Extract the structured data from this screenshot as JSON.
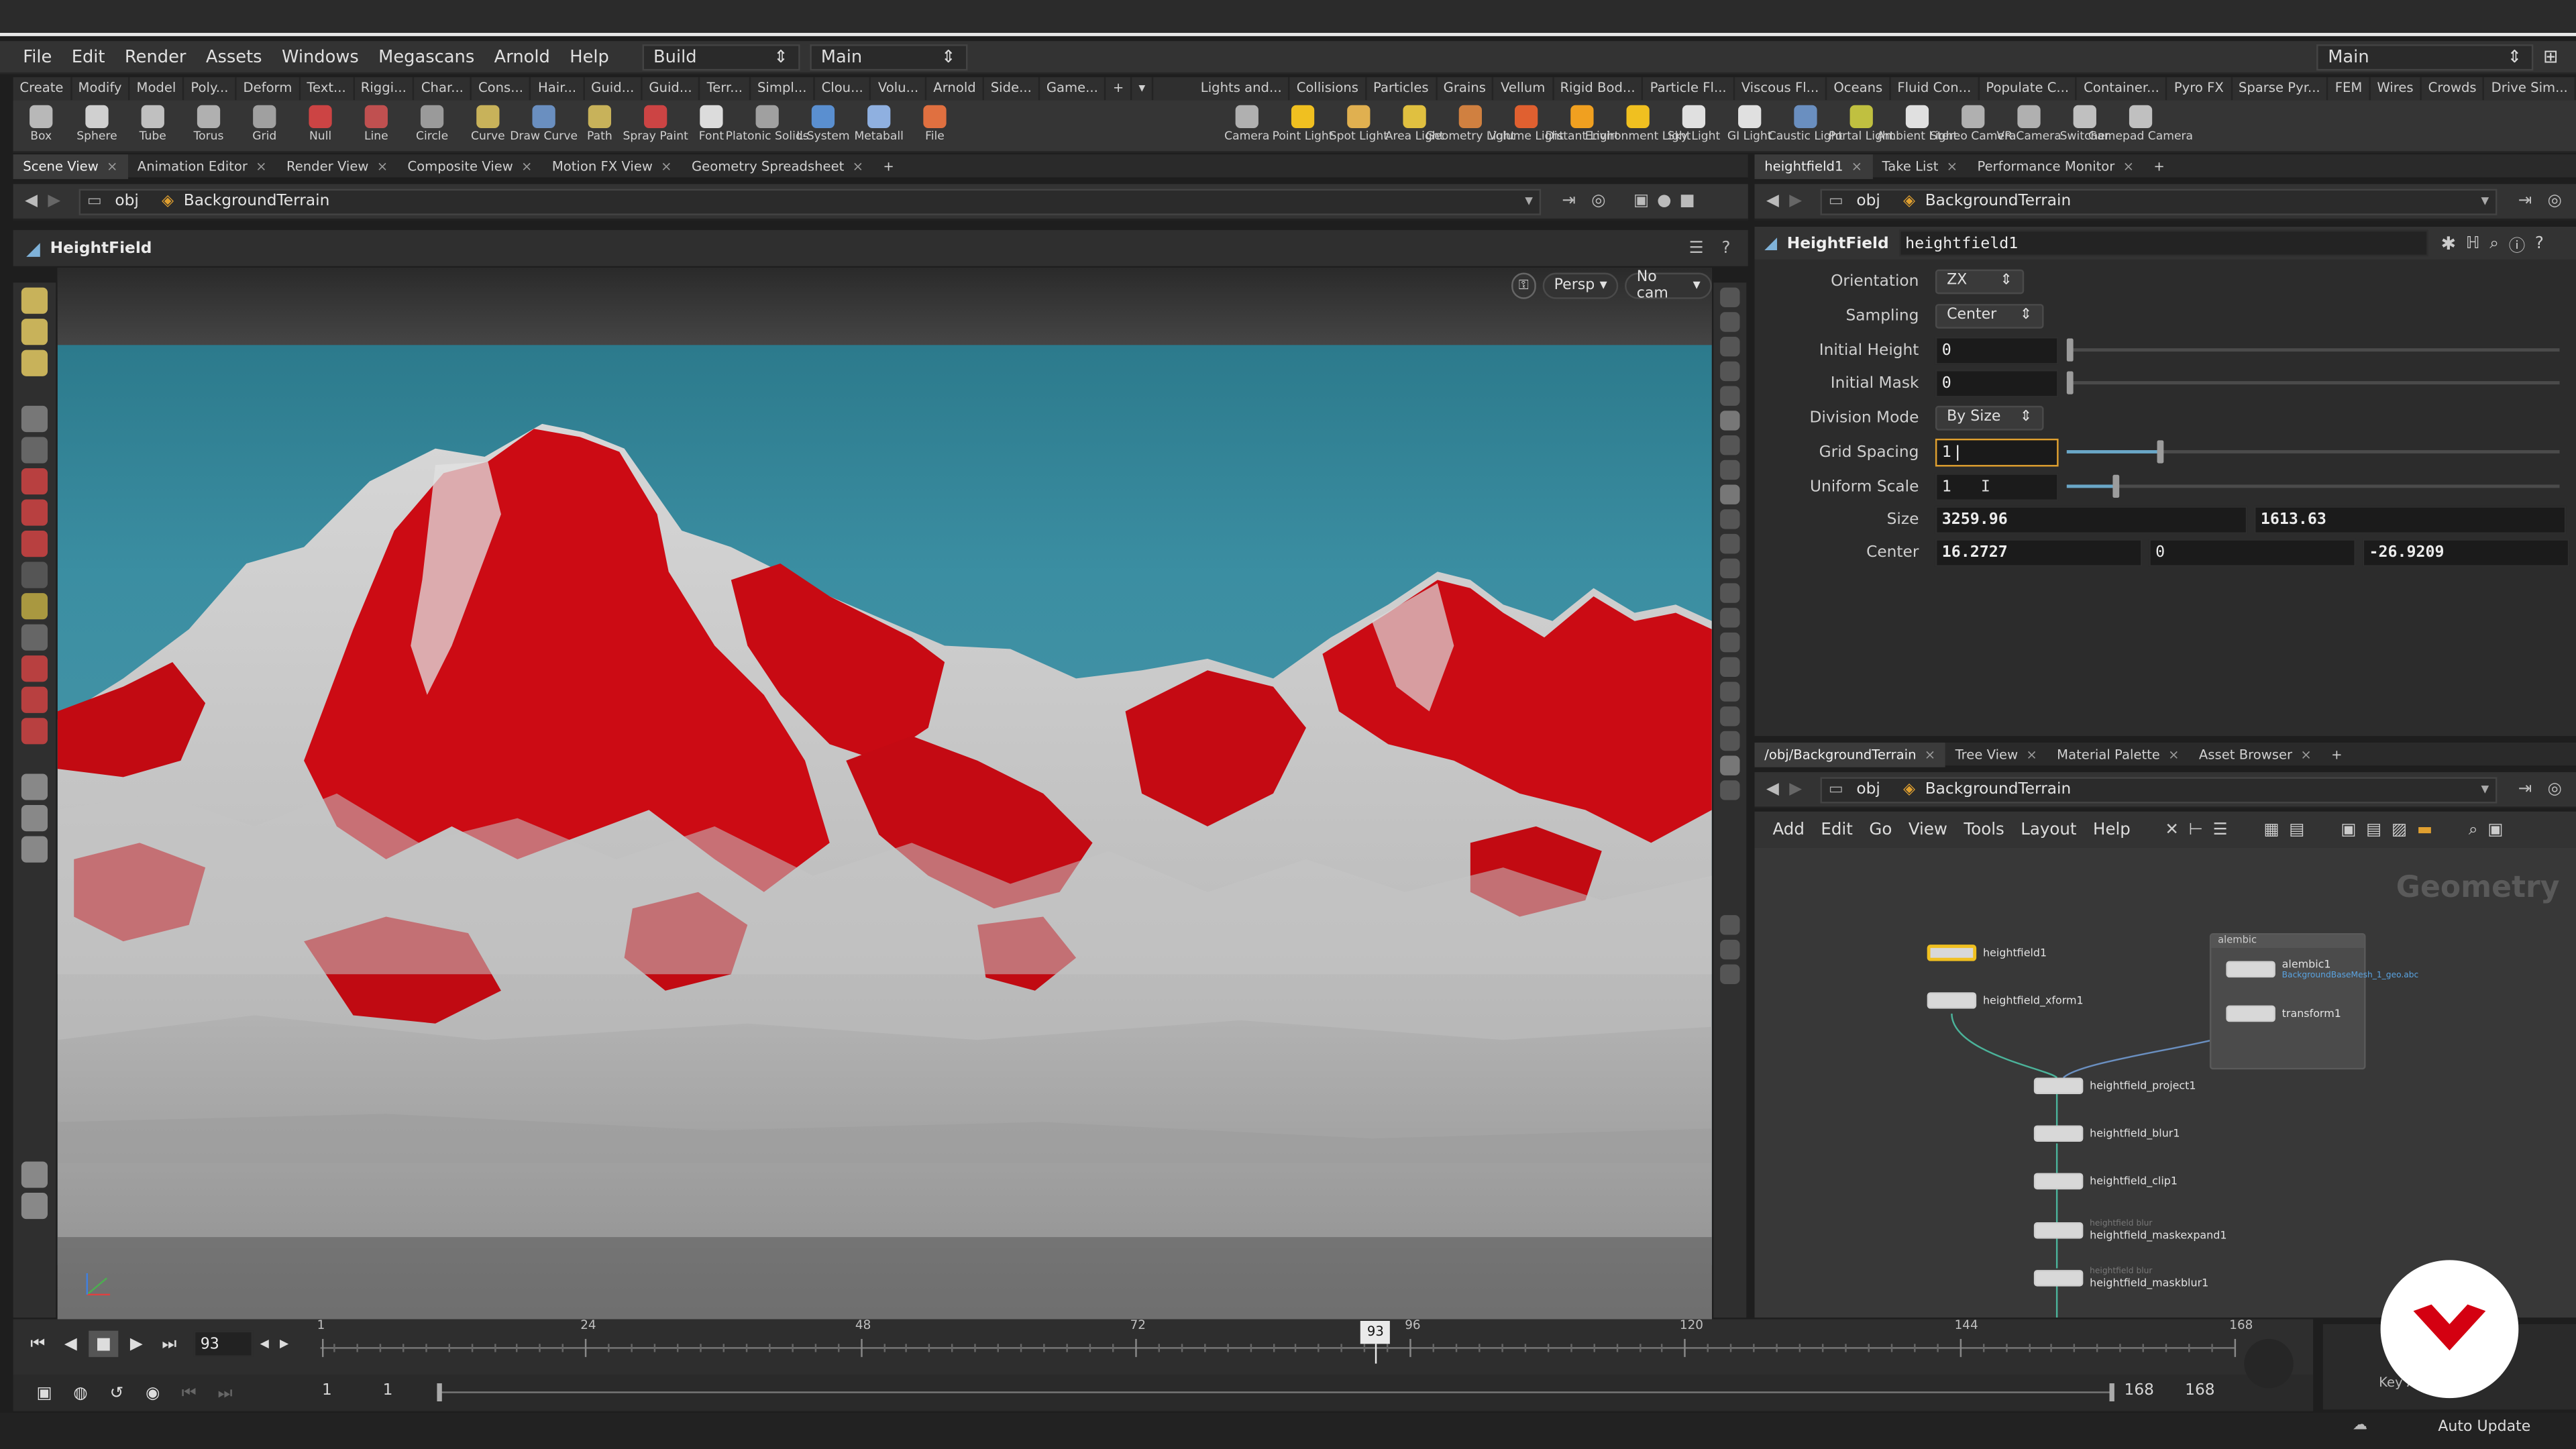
{
  "menu": {
    "items": [
      "File",
      "Edit",
      "Render",
      "Assets",
      "Windows",
      "Megascans",
      "Arnold",
      "Help"
    ],
    "desktop": "Build",
    "context": "Main",
    "right_context": "Main"
  },
  "shelf_tabs_left": [
    "Create",
    "Modify",
    "Model",
    "Poly...",
    "Deform",
    "Text...",
    "Riggi...",
    "Char...",
    "Cons...",
    "Hair...",
    "Guid...",
    "Guid...",
    "Terr...",
    "Simpl...",
    "Clou...",
    "Volu...",
    "Arnold",
    "Side...",
    "Game..."
  ],
  "shelf_tabs_right": [
    "Lights and...",
    "Collisions",
    "Particles",
    "Grains",
    "Vellum",
    "Rigid Bod...",
    "Particle Fl...",
    "Viscous Fl...",
    "Oceans",
    "Fluid Con...",
    "Populate C...",
    "Container...",
    "Pyro FX",
    "Sparse Pyr...",
    "FEM",
    "Wires",
    "Crowds",
    "Drive Sim..."
  ],
  "shelf_tools_left": [
    "Box",
    "Sphere",
    "Tube",
    "Torus",
    "Grid",
    "Null",
    "Line",
    "Circle",
    "Curve",
    "Draw Curve",
    "Path",
    "Spray Paint",
    "Font",
    "Platonic Solids",
    "L-System",
    "Metaball",
    "File"
  ],
  "shelf_tools_right": [
    "Camera",
    "Point Light",
    "Spot Light",
    "Area Light",
    "Geometry Light",
    "Volume Light",
    "Distant Light",
    "Environment Light",
    "Sky Light",
    "GI Light",
    "Caustic Light",
    "Portal Light",
    "Ambient Light",
    "Stereo Camera",
    "VR Camera",
    "Switcher",
    "Gamepad Camera"
  ],
  "viewer": {
    "tabs": [
      "Scene View",
      "Animation Editor",
      "Render View",
      "Composite View",
      "Motion FX View",
      "Geometry Spreadsheet"
    ],
    "path_root": "obj",
    "path_node": "BackgroundTerrain",
    "title": "HeightField",
    "persp": "Persp",
    "cam": "No cam"
  },
  "params": {
    "tabs": [
      "heightfield1",
      "Take List",
      "Performance Monitor"
    ],
    "path_root": "obj",
    "path_node": "BackgroundTerrain",
    "node_type": "HeightField",
    "node_name": "heightfield1",
    "orientation_label": "Orientation",
    "orientation_value": "ZX",
    "sampling_label": "Sampling",
    "sampling_value": "Center",
    "initial_height_label": "Initial Height",
    "initial_height_value": "0",
    "initial_mask_label": "Initial Mask",
    "initial_mask_value": "0",
    "division_mode_label": "Division Mode",
    "division_mode_value": "By Size",
    "grid_spacing_label": "Grid Spacing",
    "grid_spacing_value": "1",
    "grid_spacing_level": 0.19,
    "uniform_scale_label": "Uniform Scale",
    "uniform_scale_value": "1",
    "uniform_scale_level": 0.1,
    "size_label": "Size",
    "size_x": "3259.96",
    "size_y": "1613.63",
    "center_label": "Center",
    "center_x": "16.2727",
    "center_y": "0",
    "center_z": "-26.9209"
  },
  "network": {
    "tabs": [
      "/obj/BackgroundTerrain",
      "Tree View",
      "Material Palette",
      "Asset Browser"
    ],
    "path_root": "obj",
    "path_node": "BackgroundTerrain",
    "menu": [
      "Add",
      "Edit",
      "Go",
      "View",
      "Tools",
      "Layout",
      "Help"
    ],
    "context_watermark": "Geometry",
    "box_title": "alembic",
    "nodes": {
      "heightfield1": "heightfield1",
      "xform": "heightfield_xform1",
      "project": "heightfield_project1",
      "blur": "heightfield_blur1",
      "clip": "heightfield_clip1",
      "maskexpand": "heightfield_maskexpand1",
      "maskblur": "heightfield_maskblur1",
      "alembic": "alembic1",
      "alembic_file": "BackgroundBaseMesh_1_geo.abc",
      "transform": "transform1",
      "maskexpand_comment": "heightfield blur",
      "maskblur_comment": "heightfield blur"
    }
  },
  "timeline": {
    "current_frame": "93",
    "ticks": [
      "1",
      "24",
      "48",
      "72",
      "96",
      "120",
      "144",
      "168"
    ],
    "start": "1",
    "start2": "1",
    "end": "168",
    "end2": "168",
    "auto_update": "Auto Update",
    "key_label": "Key A..."
  },
  "colors": {
    "accent": "#f0c020",
    "sky": "#3e8ea0",
    "mask_red": "#d10a14",
    "terrain": "#b4b4b4",
    "logo": "#d40011"
  }
}
